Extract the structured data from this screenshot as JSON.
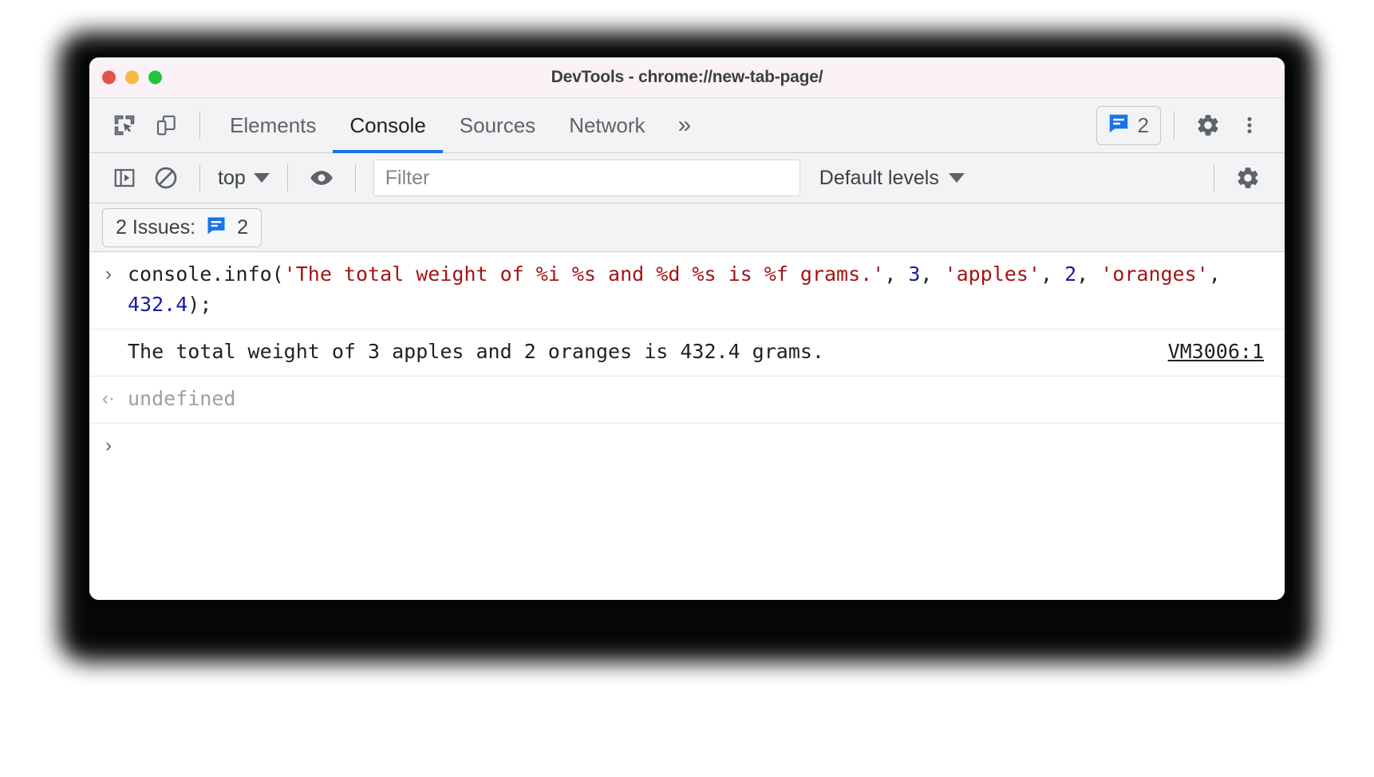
{
  "window": {
    "title": "DevTools - chrome://new-tab-page/",
    "traffic_lights": [
      "close",
      "minimize",
      "maximize"
    ]
  },
  "tabbar": {
    "inspect_icon": "inspect-element-icon",
    "device_icon": "device-toolbar-icon",
    "tabs": [
      {
        "label": "Elements",
        "active": false
      },
      {
        "label": "Console",
        "active": true
      },
      {
        "label": "Sources",
        "active": false
      },
      {
        "label": "Network",
        "active": false
      }
    ],
    "more_tabs": "»",
    "issues_count": "2",
    "issues_icon": "issues-message-icon",
    "settings_icon": "gear-icon",
    "menu_icon": "kebab-menu-icon",
    "accent_color": "#1a73e8"
  },
  "console_toolbar": {
    "sidebar_icon": "console-sidebar-icon",
    "clear_icon": "clear-console-icon",
    "context": "top",
    "eye_icon": "live-expression-icon",
    "filter_placeholder": "Filter",
    "filter_value": "",
    "levels": "Default levels",
    "settings_icon": "gear-icon"
  },
  "issues_bar": {
    "label": "2 Issues:",
    "icon": "issues-message-icon",
    "count": "2"
  },
  "console": {
    "input_prompt": "›",
    "output_prompt": "‹·",
    "entries": [
      {
        "type": "input",
        "code_parts": [
          {
            "text": "console.info(",
            "kind": "punct"
          },
          {
            "text": "'The total weight of %i %s and %d %s is %f grams.'",
            "kind": "string"
          },
          {
            "text": ", ",
            "kind": "punct"
          },
          {
            "text": "3",
            "kind": "number"
          },
          {
            "text": ", ",
            "kind": "punct"
          },
          {
            "text": "'apples'",
            "kind": "string"
          },
          {
            "text": ", ",
            "kind": "punct"
          },
          {
            "text": "2",
            "kind": "number"
          },
          {
            "text": ", ",
            "kind": "punct"
          },
          {
            "text": "'oranges'",
            "kind": "string"
          },
          {
            "text": ", ",
            "kind": "punct"
          },
          {
            "text": "432.4",
            "kind": "number"
          },
          {
            "text": ");",
            "kind": "punct"
          }
        ],
        "plain": "console.info('The total weight of %i %s and %d %s is %f grams.', 3, 'apples', 2, 'oranges', 432.4);"
      },
      {
        "type": "log",
        "text": "The total weight of 3 apples and 2 oranges is 432.4 grams.",
        "source": "VM3006:1"
      },
      {
        "type": "return",
        "text": "undefined"
      }
    ]
  },
  "colors": {
    "accent": "#1a73e8",
    "string": "#a31515",
    "number": "#1a1aa6",
    "text": "#202124",
    "muted": "#9aa0a6",
    "toolbar_bg": "#f1f3f4",
    "titlebar_bg": "#faf2f6"
  }
}
